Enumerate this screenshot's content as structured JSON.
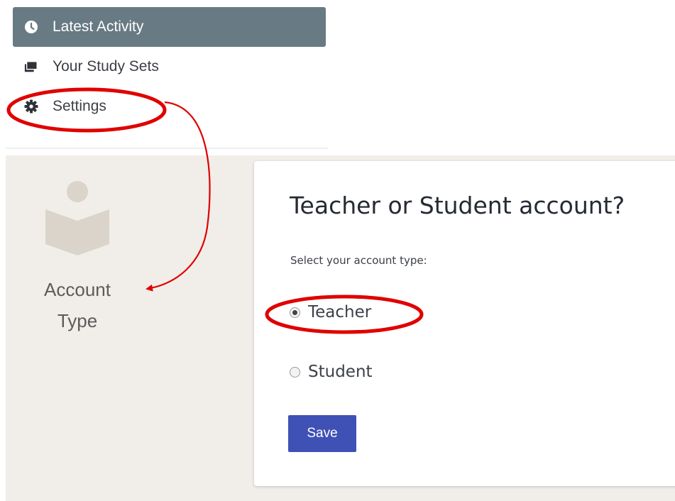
{
  "sidebar": {
    "items": [
      {
        "label": "Latest Activity",
        "icon": "clock-icon",
        "active": true
      },
      {
        "label": "Your Study Sets",
        "icon": "cards-icon",
        "active": false
      },
      {
        "label": "Settings",
        "icon": "gear-icon",
        "active": false
      }
    ]
  },
  "account_section": {
    "icon": "reader-book-icon",
    "label_line1": "Account",
    "label_line2": "Type"
  },
  "card": {
    "title": "Teacher or Student account?",
    "subtitle": "Select your account type:",
    "options": [
      {
        "label": "Teacher",
        "checked": true
      },
      {
        "label": "Student",
        "checked": false
      }
    ],
    "save_label": "Save"
  },
  "colors": {
    "active_nav": "#687a83",
    "panel_bg": "#f1eee9",
    "button": "#3f51b5",
    "annotation": "#e00000"
  }
}
